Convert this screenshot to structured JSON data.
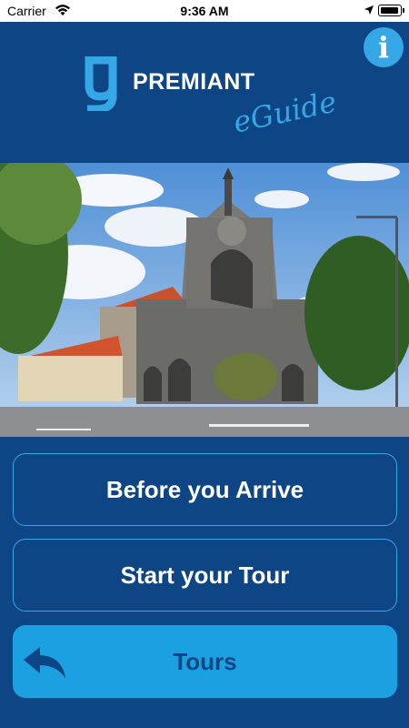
{
  "status_bar": {
    "carrier": "Carrier",
    "time": "9:36 AM"
  },
  "header": {
    "brand_name": "PREMIANT",
    "brand_sub": "eGuide",
    "info_label": "i"
  },
  "hero_image": {
    "subject": "cathedral"
  },
  "menu": {
    "before_arrive": "Before you Arrive",
    "start_tour": "Start your Tour",
    "tours": "Tours"
  },
  "colors": {
    "background": "#0e4585",
    "accent": "#35a6e6",
    "tours_button": "#1ba1e2"
  }
}
